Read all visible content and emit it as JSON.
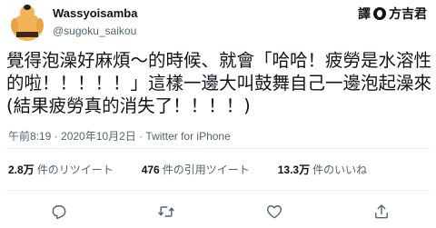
{
  "user": {
    "display_name": "Wassyoisamba",
    "handle": "@sugoku_saikou"
  },
  "watermark": {
    "prefix": "譯",
    "name": "方吉君"
  },
  "tweet": {
    "lines": [
      "覺得泡澡好麻煩～的時候、就會「哈哈！疲勞是水溶性",
      "的啦！！！！！」這樣一邊大叫鼓舞自己一邊泡起澡來",
      "(結果疲勞真的消失了！！！！)"
    ],
    "meta": "午前8:19 · 2020年10月2日 · Twitter for iPhone"
  },
  "stats": [
    {
      "count": "2.8万",
      "label": "件のリツイート"
    },
    {
      "count": "476",
      "label": "件の引用ツイート"
    },
    {
      "count": "13.3万",
      "label": "件のいいね"
    }
  ],
  "actions": [
    {
      "icon": "reply-icon"
    },
    {
      "icon": "retweet-icon"
    },
    {
      "icon": "like-icon"
    },
    {
      "icon": "share-icon"
    }
  ],
  "colors": {
    "text": "#0f1419",
    "secondary": "#536471",
    "divider": "#eff3f4",
    "avatar_skin": "#f2b457"
  }
}
